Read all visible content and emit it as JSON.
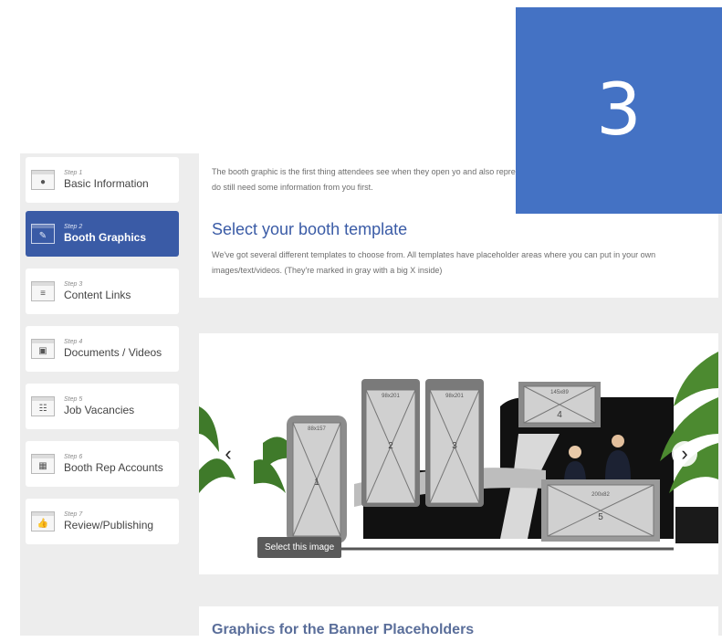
{
  "badge": {
    "number": "3",
    "color": "#4472c4"
  },
  "sidebar": {
    "items": [
      {
        "step": "Step 1",
        "label": "Basic Information",
        "icon": "user-profile-icon",
        "active": false
      },
      {
        "step": "Step 2",
        "label": "Booth Graphics",
        "icon": "graphics-edit-icon",
        "active": true
      },
      {
        "step": "Step 3",
        "label": "Content Links",
        "icon": "content-lines-icon",
        "active": false
      },
      {
        "step": "Step 4",
        "label": "Documents / Videos",
        "icon": "documents-videos-icon",
        "active": false
      },
      {
        "step": "Step 5",
        "label": "Job Vacancies",
        "icon": "job-grid-icon",
        "active": false
      },
      {
        "step": "Step 6",
        "label": "Booth Rep Accounts",
        "icon": "rep-accounts-icon",
        "active": false
      },
      {
        "step": "Step 7",
        "label": "Review/Publishing",
        "icon": "thumbs-up-icon",
        "active": false
      }
    ]
  },
  "intro": {
    "paragraph1": "The booth graphic is the first thing attendees see when they open yo and also representative of your brand. Our graphic designers can do still need some information from you first.",
    "title": "Select your booth template",
    "paragraph2": "We've got several different templates to choose from. All templates have placeholder areas where you can put in your own images/text/videos. (They're marked in gray with a big X inside)"
  },
  "carousel": {
    "prev_label": "‹",
    "next_label": "›",
    "select_button": "Select this image",
    "placeholders": [
      {
        "number": "1",
        "size": "88x157"
      },
      {
        "number": "2",
        "size": "98x201"
      },
      {
        "number": "3",
        "size": "98x201"
      },
      {
        "number": "4",
        "size": "145x89"
      },
      {
        "number": "5",
        "size": "200x82"
      }
    ]
  },
  "bottom": {
    "title": "Graphics for the Banner Placeholders"
  },
  "colors": {
    "accent": "#3a5ba6",
    "background": "#ededed"
  }
}
